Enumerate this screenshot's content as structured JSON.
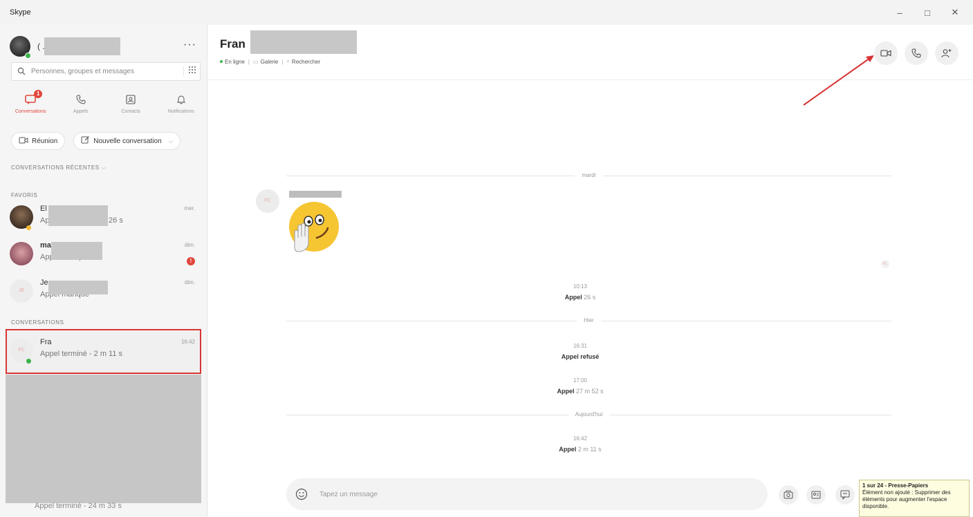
{
  "window": {
    "title": "Skype",
    "controls": [
      "–",
      "□",
      "✕"
    ]
  },
  "profile": {
    "name": "( ... )"
  },
  "search": {
    "placeholder": "Personnes, groupes et messages"
  },
  "nav": [
    {
      "label": "Conversations",
      "badge": "1"
    },
    {
      "label": "Appels"
    },
    {
      "label": "Contacts"
    },
    {
      "label": "Notifications"
    }
  ],
  "actions": {
    "meeting": "Réunion",
    "new_conversation": "Nouvelle conversation"
  },
  "sections": {
    "recent": "CONVERSATIONS RÉCENTES",
    "favorites": "FAVORIS",
    "conversations": "CONVERSATIONS"
  },
  "favorites": [
    {
      "name": "El",
      "sub": "Appel terminé - 4 m 26 s",
      "time": "mer."
    },
    {
      "name": "ma",
      "sub": "Appel manqué",
      "time": "dim.",
      "unread": "!"
    },
    {
      "name": "Je",
      "sub": "Appel manqué",
      "time": "dim.",
      "initials": "JE"
    }
  ],
  "conversations": [
    {
      "name": "Fra",
      "sub": "Appel terminé - 2 m 11 s",
      "time": "16:42",
      "initials": "FC"
    }
  ],
  "peek_item": {
    "sub": "Appel terminé - 24 m 33 s"
  },
  "chat": {
    "name": "Fran",
    "status_online": "En ligne",
    "gallery": "Galerie",
    "search": "Rechercher",
    "sender_initials": "FC",
    "day_tuesday": "mardi",
    "day_yesterday": "Hier",
    "day_today": "Aujourd'hui",
    "events": [
      {
        "time": "10:13",
        "label": "Appel",
        "duration": "26 s"
      },
      {
        "time": "16:31",
        "label": "Appel refusé",
        "duration": ""
      },
      {
        "time": "17:00",
        "label": "Appel",
        "duration": "27 m 52 s"
      },
      {
        "time": "16:42",
        "label": "Appel",
        "duration": "2 m 11 s"
      }
    ]
  },
  "composer": {
    "placeholder": "Tapez un message"
  },
  "tooltip": {
    "title": "1 sur 24 - Presse-Papiers",
    "body": "Élément non ajouté : Supprimer des éléments pour augmenter l'espace disponible."
  },
  "colors": {
    "accent_red": "#e0463c",
    "online_green": "#3bb34a",
    "highlight_border": "#d83434"
  }
}
